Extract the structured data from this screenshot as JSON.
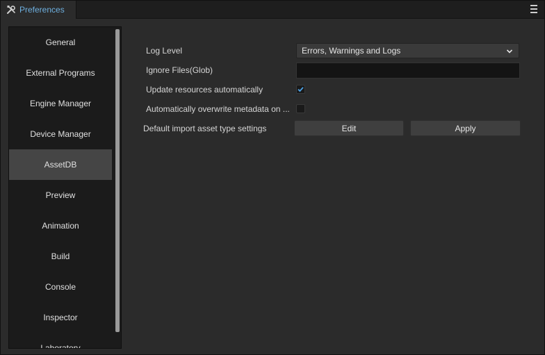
{
  "window": {
    "tab_label": "Preferences",
    "tab_icon": "tools-icon",
    "menu_icon": "hamburger-menu-icon"
  },
  "sidebar": {
    "items": [
      {
        "label": "General",
        "active": false
      },
      {
        "label": "External Programs",
        "active": false
      },
      {
        "label": "Engine Manager",
        "active": false
      },
      {
        "label": "Device Manager",
        "active": false
      },
      {
        "label": "AssetDB",
        "active": true
      },
      {
        "label": "Preview",
        "active": false
      },
      {
        "label": "Animation",
        "active": false
      },
      {
        "label": "Build",
        "active": false
      },
      {
        "label": "Console",
        "active": false
      },
      {
        "label": "Inspector",
        "active": false
      },
      {
        "label": "Laboratory",
        "active": false
      }
    ]
  },
  "assetdb": {
    "log_level": {
      "label": "Log Level",
      "value": "Errors, Warnings and Logs"
    },
    "ignore_files": {
      "label": "Ignore Files(Glob)",
      "value": ""
    },
    "update_resources": {
      "label": "Update resources automatically",
      "checked": true
    },
    "overwrite_metadata": {
      "label": "Automatically overwrite metadata on ...",
      "checked": false
    },
    "default_import": {
      "label": "Default import asset type settings",
      "edit_label": "Edit",
      "apply_label": "Apply"
    }
  },
  "colors": {
    "accent": "#6eb0e0",
    "active_item": "#454545",
    "check": "#4da3e6"
  }
}
